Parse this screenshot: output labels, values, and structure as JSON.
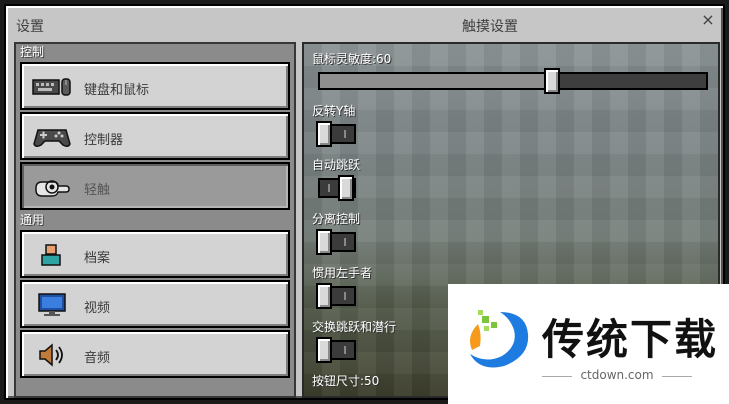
{
  "window": {
    "left_title": "设置",
    "center_title": "触摸设置",
    "close_glyph": "×"
  },
  "sidebar": {
    "section_control": "控制",
    "section_general": "通用",
    "control_items": [
      {
        "label": "键盘和鼠标",
        "icon": "keyboard-mouse-icon",
        "selected": false
      },
      {
        "label": "控制器",
        "icon": "gamepad-icon",
        "selected": false
      },
      {
        "label": "轻触",
        "icon": "touch-hand-icon",
        "selected": true
      }
    ],
    "general_items": [
      {
        "label": "档案",
        "icon": "profile-icon"
      },
      {
        "label": "视频",
        "icon": "monitor-icon"
      },
      {
        "label": "音频",
        "icon": "speaker-icon"
      }
    ]
  },
  "settings": {
    "sensitivity_label": "鼠标灵敏度:60",
    "sensitivity_value": 60,
    "invert_y_label": "反转Y轴",
    "invert_y_on": false,
    "auto_jump_label": "自动跳跃",
    "auto_jump_on": true,
    "split_controls_label": "分离控制",
    "split_controls_on": false,
    "left_handed_label": "惯用左手者",
    "left_handed_on": false,
    "swap_jump_sneak_label": "交换跳跃和潜行",
    "swap_jump_sneak_on": false,
    "button_size_label": "按钮尺寸:50"
  },
  "watermark": {
    "title": "传统下载",
    "subtitle": "ctdown.com"
  },
  "colors": {
    "panel": "#c6c6c6",
    "button": "#d3d3d3",
    "selected_button": "#9a9a9a",
    "logo_green": "#7cc53a",
    "logo_blue": "#1e7be0",
    "logo_orange": "#f59a1b"
  }
}
